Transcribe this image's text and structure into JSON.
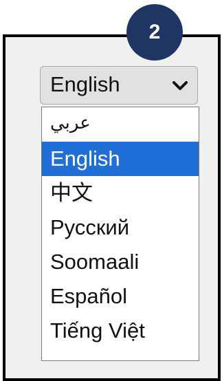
{
  "step_badge": "2",
  "language_select": {
    "value": "English",
    "chevron_icon": "chevron-down-icon"
  },
  "options": [
    "عربي",
    "English",
    "中文",
    "Русский",
    "Soomaali",
    "Español",
    "Tiếng Việt"
  ],
  "selected_index": 1,
  "colors": {
    "badge": "#1f3664",
    "selected": "#1f6fd6",
    "frame_border": "#000000"
  }
}
